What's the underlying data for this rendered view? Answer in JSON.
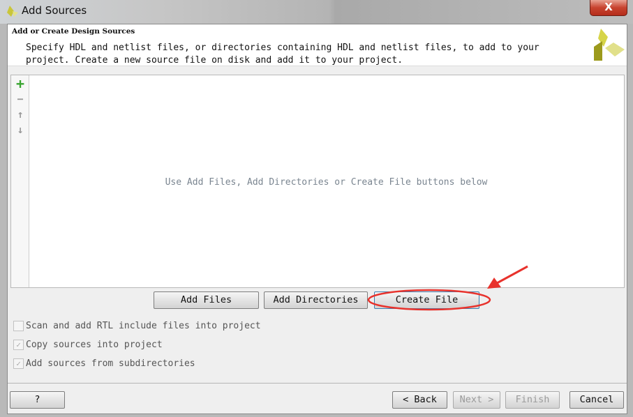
{
  "window": {
    "title": "Add Sources",
    "close_label": "X"
  },
  "header": {
    "title": "Add or Create Design Sources",
    "description": "Specify HDL and netlist files, or directories containing HDL and netlist files, to add to your project. Create a new source file on disk and add it to your project."
  },
  "list": {
    "empty_hint": "Use Add Files, Add Directories or Create File buttons below",
    "toolbar": [
      "add-icon",
      "remove-icon",
      "move-up-icon",
      "move-down-icon"
    ]
  },
  "buttons": {
    "add_files": "Add Files",
    "add_directories": "Add Directories",
    "create_file": "Create File"
  },
  "options": [
    {
      "label": "Scan and add RTL include files into project",
      "checked": false
    },
    {
      "label": "Copy sources into project",
      "checked": true
    },
    {
      "label": "Add sources from subdirectories",
      "checked": true
    }
  ],
  "footer": {
    "help": "?",
    "back": "< Back",
    "next": "Next >",
    "finish": "Finish",
    "cancel": "Cancel"
  },
  "colors": {
    "annotation": "#e8322c",
    "add_icon": "#3aa531",
    "logo": "#c9c63a"
  }
}
